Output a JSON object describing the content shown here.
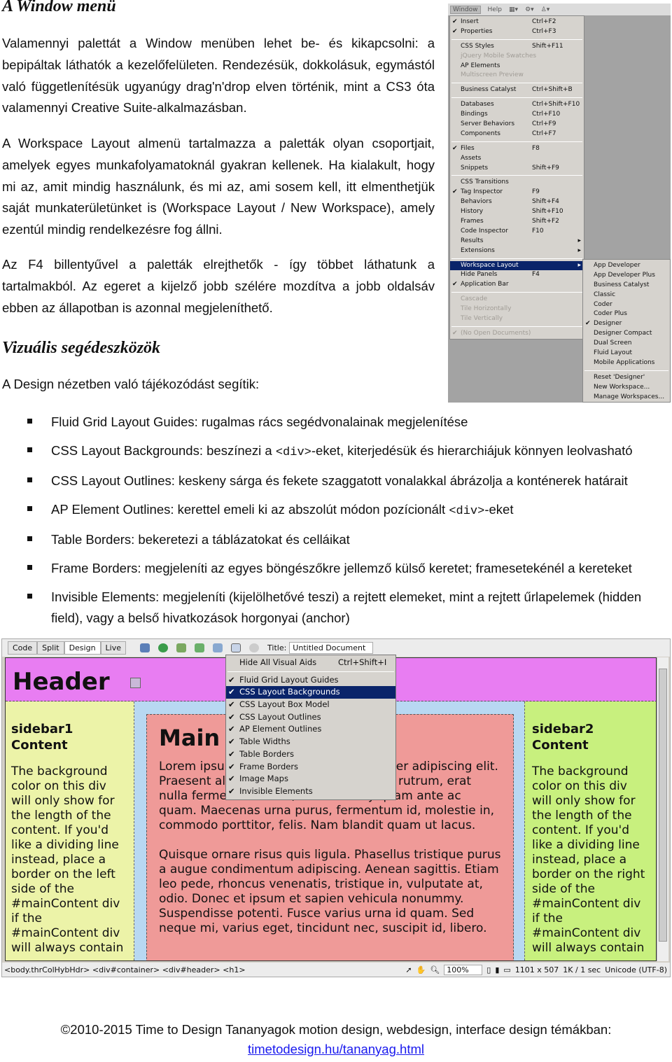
{
  "section1": {
    "title": "A Window menü",
    "paragraphs": [
      "Valamennyi palettát a Window menüben lehet be- és kikapcsolni: a bepipáltak láthatók a kezelőfelületen. Rendezésük, dokkolásuk, egymástól való függetlenítésük ugyanúgy drag'n'drop elven történik, mint a CS3 óta valamennyi Creative Suite-alkalmazásban.",
      "A Workspace Layout almenü tartalmazza a paletták olyan csoportjait, amelyek egyes munkafolyamatoknál gyakran kellenek. Ha kialakult, hogy mi az, amit mindig használunk, és mi az, ami sosem kell, itt elmenthetjük saját munkaterületünket is (Workspace Layout / New Workspace), amely ezentúl mindig rendelkezésre fog állni.",
      "Az F4 billentyűvel a paletták elrejthetők - így többet láthatunk a tartalmakból. Az egeret a kijelző jobb szélére mozdítva a jobb oldalsáv ebben az állapotban is azonnal megjeleníthető."
    ]
  },
  "window_menu": {
    "menubar": [
      "Window",
      "Help",
      "▦▾",
      "⚙▾",
      "♙▾"
    ],
    "items": [
      {
        "label": "Insert",
        "shortcut": "Ctrl+F2",
        "checked": true
      },
      {
        "label": "Properties",
        "shortcut": "Ctrl+F3",
        "checked": true
      },
      {
        "sep": true
      },
      {
        "label": "CSS Styles",
        "shortcut": "Shift+F11"
      },
      {
        "label": "jQuery Mobile Swatches",
        "disabled": true
      },
      {
        "label": "AP Elements"
      },
      {
        "label": "Multiscreen Preview",
        "disabled": true
      },
      {
        "sep": true
      },
      {
        "label": "Business Catalyst",
        "shortcut": "Ctrl+Shift+B"
      },
      {
        "sep": true
      },
      {
        "label": "Databases",
        "shortcut": "Ctrl+Shift+F10"
      },
      {
        "label": "Bindings",
        "shortcut": "Ctrl+F10"
      },
      {
        "label": "Server Behaviors",
        "shortcut": "Ctrl+F9"
      },
      {
        "label": "Components",
        "shortcut": "Ctrl+F7"
      },
      {
        "sep": true
      },
      {
        "label": "Files",
        "shortcut": "F8",
        "checked": true
      },
      {
        "label": "Assets"
      },
      {
        "label": "Snippets",
        "shortcut": "Shift+F9"
      },
      {
        "sep": true
      },
      {
        "label": "CSS Transitions"
      },
      {
        "label": "Tag Inspector",
        "shortcut": "F9",
        "checked": true
      },
      {
        "label": "Behaviors",
        "shortcut": "Shift+F4"
      },
      {
        "label": "History",
        "shortcut": "Shift+F10"
      },
      {
        "label": "Frames",
        "shortcut": "Shift+F2"
      },
      {
        "label": "Code Inspector",
        "shortcut": "F10"
      },
      {
        "label": "Results",
        "submenu": true
      },
      {
        "label": "Extensions",
        "submenu": true
      },
      {
        "sep": true
      },
      {
        "label": "Workspace Layout",
        "submenu": true,
        "highlighted": true
      },
      {
        "label": "Hide Panels",
        "shortcut": "F4"
      },
      {
        "label": "Application Bar",
        "checked": true
      },
      {
        "sep": true
      },
      {
        "label": "Cascade",
        "disabled": true
      },
      {
        "label": "Tile Horizontally",
        "disabled": true
      },
      {
        "label": "Tile Vertically",
        "disabled": true
      },
      {
        "sep": true
      },
      {
        "label": "(No Open Documents)",
        "disabled": true,
        "checked": true
      }
    ],
    "submenu": [
      {
        "label": "App Developer"
      },
      {
        "label": "App Developer Plus"
      },
      {
        "label": "Business Catalyst"
      },
      {
        "label": "Classic"
      },
      {
        "label": "Coder"
      },
      {
        "label": "Coder Plus"
      },
      {
        "label": "Designer",
        "checked": true
      },
      {
        "label": "Designer Compact"
      },
      {
        "label": "Dual Screen"
      },
      {
        "label": "Fluid Layout"
      },
      {
        "label": "Mobile Applications"
      },
      {
        "sep": true
      },
      {
        "label": "Reset 'Designer'"
      },
      {
        "label": "New Workspace..."
      },
      {
        "label": "Manage Workspaces..."
      }
    ]
  },
  "section2": {
    "title": "Vizuális segédeszközök",
    "intro": "A Design nézetben való tájékozódást segítik:",
    "bullets": [
      [
        "Fluid Grid Layout Guides: rugalmas rács segédvonalainak megjelenítése"
      ],
      [
        "CSS Layout Backgrounds: beszínezi a ",
        "<div>",
        "-eket, kiterjedésük és hierarchiájuk könnyen leolvasható"
      ],
      [
        "CSS Layout Outlines: keskeny sárga és fekete szaggatott vonalakkal ábrázolja a konténerek határait"
      ],
      [
        "AP Element Outlines: kerettel emeli ki az abszolút módon pozícionált ",
        "<div>",
        "-eket"
      ],
      [
        "Table Borders: bekeretezi a táblázatokat és celláikat"
      ],
      [
        "Frame Borders: megjeleníti az egyes böngészőkre jellemző külső keretet; framesetekénél a kereteket"
      ],
      [
        "Invisible Elements: megjeleníti (kijelölhetővé teszi) a rejtett elemeket, mint a rejtett űrlapelemek (hidden field), vagy a belső hivatkozások horgonyai (anchor)"
      ]
    ]
  },
  "dreamweaver": {
    "view_tabs": [
      "Code",
      "Split",
      "Design",
      "Live"
    ],
    "active_tab": "Design",
    "title_label": "Title:",
    "title_value": "Untitled Document",
    "visual_aids_menu": [
      {
        "label": "Hide All Visual Aids",
        "shortcut": "Ctrl+Shift+I"
      },
      {
        "sep": true
      },
      {
        "label": "Fluid Grid Layout Guides",
        "checked": true
      },
      {
        "label": "CSS Layout Backgrounds",
        "checked": true,
        "highlighted": true
      },
      {
        "label": "CSS Layout Box Model",
        "checked": true
      },
      {
        "label": "CSS Layout Outlines",
        "checked": true
      },
      {
        "label": "AP Element Outlines",
        "checked": true
      },
      {
        "label": "Table Widths",
        "checked": true
      },
      {
        "label": "Table Borders",
        "checked": true
      },
      {
        "label": "Frame Borders",
        "checked": true
      },
      {
        "label": "Image Maps",
        "checked": true
      },
      {
        "label": "Invisible Elements",
        "checked": true
      }
    ],
    "header": "Header",
    "main_title": "Main Content",
    "main_p1": "Lorem ipsum dolor sit amet, consectetuer adipiscing elit. Praesent aliquam, justo convallis luctus rutrum, erat nulla fermentum diam, at nonummy quam ante ac quam. Maecenas urna purus, fermentum id, molestie in, commodo porttitor, felis. Nam blandit quam ut lacus.",
    "main_p2": "Quisque ornare risus quis ligula. Phasellus tristique purus a augue condimentum adipiscing. Aenean sagittis. Etiam leo pede, rhoncus venenatis, tristique in, vulputate at, odio. Donec et ipsum et sapien vehicula nonummy. Suspendisse potenti. Fusce varius urna id quam. Sed neque mi, varius eget, tincidunt nec, suscipit id, libero.",
    "sidebar1_title": "sidebar1 Content",
    "sidebar1_text": "The background color on this div will only show for the length of the content. If you'd like a dividing line instead, place a border on the left side of the #mainContent div if the #mainContent div will always contain",
    "sidebar2_title": "sidebar2 Content",
    "sidebar2_text": "The background color on this div will only show for the length of the content. If you'd like a dividing line instead, place a border on the right side of the #mainContent div if the #mainContent div will always contain",
    "status": {
      "tag_path": "<body.thrColHybHdr> <div#container> <div#header> <h1>",
      "zoom": "100%",
      "size": "1101 x 507",
      "download": "1K / 1 sec",
      "encoding": "Unicode (UTF-8)"
    }
  },
  "footer": {
    "text": "©2010-2015 Time to Design Tananyagok motion design, webdesign, interface design témákban:",
    "link": "timetodesign.hu/tananyag.html"
  }
}
